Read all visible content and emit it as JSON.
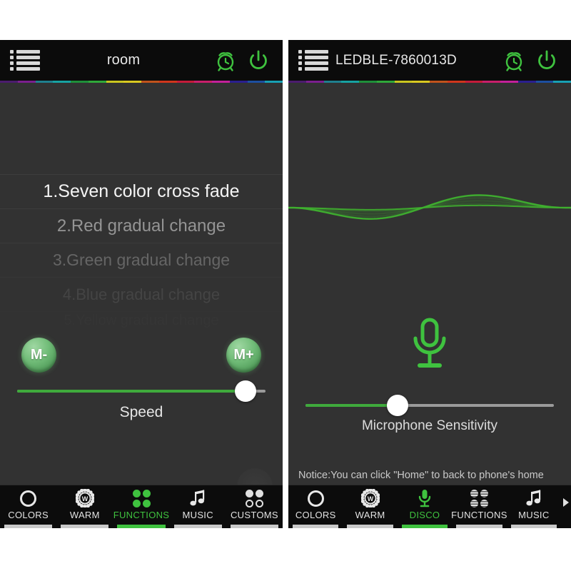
{
  "theme": {
    "panel_bg": "#323232",
    "header_bg": "#0b0b0b",
    "accent_green": "#3fc23f",
    "slider_green": "#3faa3c",
    "text_primary": "#f2f2f2",
    "text_muted": "#c9c9c9",
    "rainbow_colors": [
      "#4b1c6e",
      "#7b1f8f",
      "#1f7f8f",
      "#17a2a2",
      "#1f8f3a",
      "#2fa83a",
      "#c9c51f",
      "#d8c820",
      "#c0531c",
      "#d0361c",
      "#c41b3a",
      "#c81f6b",
      "#c3209a",
      "#2a1f8f",
      "#1d4fa0",
      "#18a0b4"
    ]
  },
  "left_panel": {
    "header": {
      "menu_icon": "list-menu-icon",
      "title": "room",
      "alarm_icon": "alarm-clock-icon",
      "power_icon": "power-icon"
    },
    "function_list": [
      {
        "label": "1.Seven color cross fade"
      },
      {
        "label": "2.Red  gradual change"
      },
      {
        "label": "3.Green gradual change"
      },
      {
        "label": "4.Blue gradual change"
      },
      {
        "label": "5.Yellow gradual change"
      }
    ],
    "mode_minus_label": "M-",
    "mode_plus_label": "M+",
    "speed_slider": {
      "label": "Speed",
      "value_percent": 92
    },
    "tabs": [
      {
        "label": "COLORS",
        "icon": "ring-icon",
        "active": false
      },
      {
        "label": "WARM",
        "icon": "warm-sun-w-icon",
        "active": false
      },
      {
        "label": "FUNCTIONS",
        "icon": "four-dots-icon",
        "active": true
      },
      {
        "label": "MUSIC",
        "icon": "music-note-icon",
        "active": false
      },
      {
        "label": "CUSTOMS",
        "icon": "customs-dots-icon",
        "active": false
      }
    ]
  },
  "right_panel": {
    "header": {
      "menu_icon": "list-menu-icon",
      "title": "LEDBLE-7860013D",
      "alarm_icon": "alarm-clock-icon",
      "power_icon": "power-icon"
    },
    "waveform_icon": "audio-waveform",
    "mic_icon": "microphone-icon",
    "mic_slider": {
      "label": "Microphone Sensitivity",
      "value_percent": 37
    },
    "notice": "Notice:You can click \"Home\" to back to phone's home screen,and play music by any app.Then,your lighting will dance with music.",
    "tabs": [
      {
        "label": "COLORS",
        "icon": "ring-icon",
        "active": false
      },
      {
        "label": "WARM",
        "icon": "warm-sun-w-icon",
        "active": false
      },
      {
        "label": "DISCO",
        "icon": "microphone-icon",
        "active": true
      },
      {
        "label": "FUNCTIONS",
        "icon": "four-striped-dots-icon",
        "active": false
      },
      {
        "label": "MUSIC",
        "icon": "music-note-icon",
        "active": false
      }
    ],
    "more_tabs_icon": "chevron-right-icon"
  }
}
